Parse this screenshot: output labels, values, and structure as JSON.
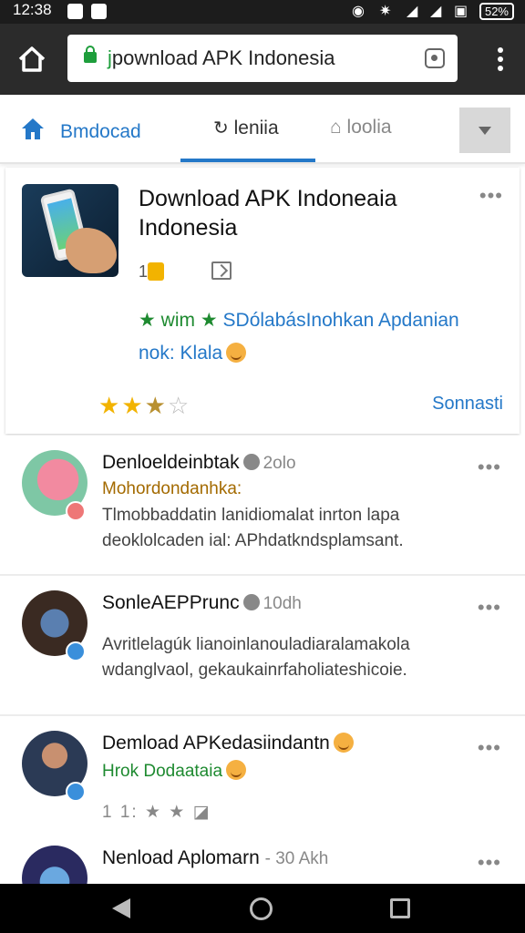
{
  "status_bar": {
    "time": "12:38",
    "battery": "52%"
  },
  "url_bar": {
    "scheme": "j",
    "url_rest": "pownload APK Indonesia"
  },
  "tabs": [
    {
      "label": "Bmdocad",
      "state": "inactive"
    },
    {
      "label": "leniia",
      "state": "active"
    },
    {
      "label": "loolia",
      "state": "inactive"
    }
  ],
  "featured": {
    "title": "Download APK Indoneaia Indonesia",
    "count": "1",
    "tagline_green": "wim",
    "tagline_blue": "SDólabásInohkan Apdanian",
    "tagline_line2": "nok: Klala",
    "rating": 2.5,
    "rating_max": 5,
    "link": "Sonnasti"
  },
  "posts": [
    {
      "title": "Denloeldeinbtak",
      "time": "2olo",
      "subtitle": "Mohordondanhka:",
      "subtitle_color": "#a36a00",
      "body": "Tlmobbaddatin lanidiomalat inrton lapa deoklolcaden ial: APhdatkndsplamsant.",
      "avatar": "pig-cartoon",
      "badge": "red"
    },
    {
      "title": "SonleAEPPrunc",
      "time": "10dh",
      "body": "Avritlelagúk lianoinlanouladiaralamakola wdanglvaol, gekaukainrfaholiateshicoie.",
      "avatar": "phone",
      "badge": "blue"
    },
    {
      "title": "Demload APKedasiindantn",
      "subtitle": "Hrok Dodaataia",
      "subtitle_color": "#1e8a30",
      "meta": "1 1: ★ ★",
      "avatar": "man-glasses",
      "badge": "blue"
    },
    {
      "title": "Nenload Aplomarn",
      "time": "- 30 Akh",
      "avatar": "phone",
      "badge": "blue"
    }
  ],
  "icons": {
    "home": "home-icon",
    "lock": "lock-icon",
    "tabs": "tabs-icon",
    "menu": "overflow-menu-icon",
    "more": "more-horizontal-icon",
    "share": "share-icon",
    "clock": "clock-icon",
    "nav_back": "back-icon",
    "nav_home": "home-circle-icon",
    "nav_recent": "recents-icon"
  },
  "colors": {
    "accent": "#2478c8",
    "green": "#1e8a30",
    "star": "#f2b300",
    "topbar": "#2b2b2b"
  }
}
